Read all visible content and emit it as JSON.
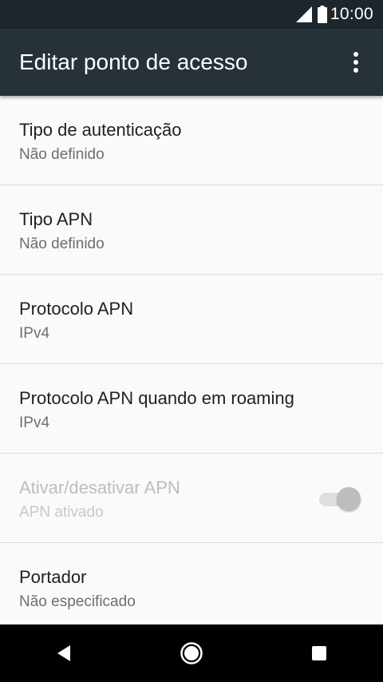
{
  "status_bar": {
    "time": "10:00",
    "icons": [
      "signal-icon",
      "battery-icon"
    ]
  },
  "app_bar": {
    "title": "Editar ponto de acesso",
    "menu_icon": "more-vert-icon"
  },
  "settings": [
    {
      "title": "Tipo de autenticação",
      "summary": "Não definido"
    },
    {
      "title": "Tipo APN",
      "summary": "Não definido"
    },
    {
      "title": "Protocolo APN",
      "summary": "IPv4"
    },
    {
      "title": "Protocolo APN quando em roaming",
      "summary": "IPv4"
    },
    {
      "title": "Ativar/desativar APN",
      "summary": "APN ativado",
      "toggle_on": true,
      "enabled": false
    },
    {
      "title": "Portador",
      "summary": "Não especificado"
    }
  ],
  "nav_bar": {
    "buttons": [
      "back-icon",
      "home-icon",
      "recents-icon"
    ]
  },
  "colors": {
    "status_bar": "#1d262c",
    "app_bar": "#263238",
    "background": "#fafafa",
    "nav_bar": "#000000"
  }
}
